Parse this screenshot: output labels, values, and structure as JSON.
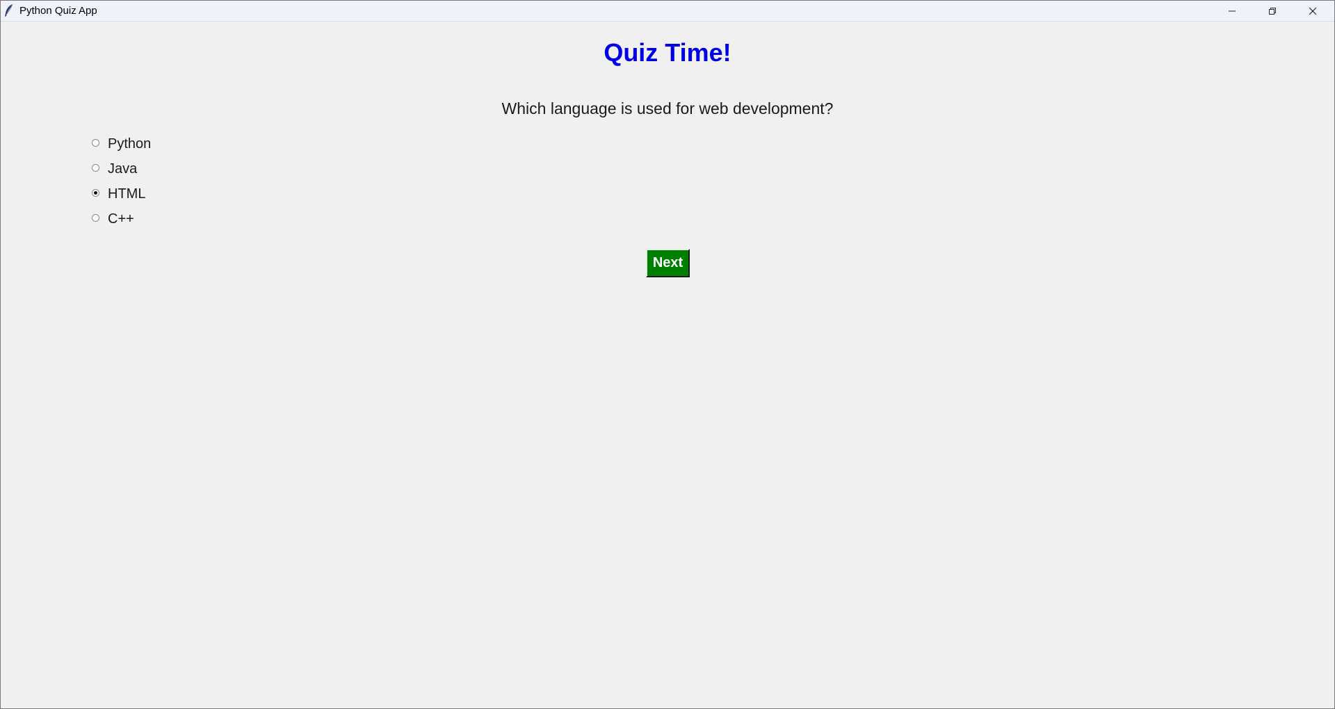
{
  "window": {
    "title": "Python Quiz App",
    "icon": "feather-icon"
  },
  "window_controls": {
    "minimize_icon": "minimize-icon",
    "restore_icon": "restore-icon",
    "close_icon": "close-icon"
  },
  "quiz": {
    "heading": "Quiz Time!",
    "question": "Which language is used for web development?",
    "options": [
      {
        "label": "Python",
        "selected": false
      },
      {
        "label": "Java",
        "selected": false
      },
      {
        "label": "HTML",
        "selected": true
      },
      {
        "label": "C++",
        "selected": false
      }
    ],
    "next_label": "Next"
  },
  "colors": {
    "heading": "#0000e6",
    "next_button_bg": "#008000",
    "background": "#f0f0f0"
  }
}
